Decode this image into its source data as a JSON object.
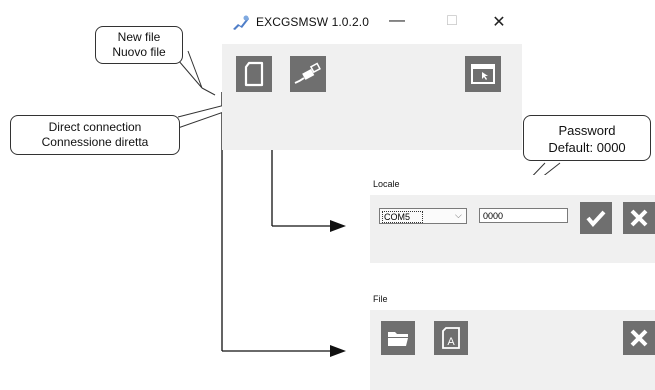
{
  "window": {
    "title": "EXCGSMSW 1.0.2.0",
    "controls": {
      "minimize": "—",
      "maximize": "□",
      "close": "✕"
    }
  },
  "toolbar": {
    "new_file_icon": "document-icon",
    "direct_connection_icon": "usb-cable-icon",
    "window_icon": "app-window-icon"
  },
  "callouts": {
    "new_file": [
      "New file",
      "Nuovo file"
    ],
    "direct_connection": [
      "Direct connection",
      "Connessione diretta"
    ],
    "password": [
      "Password",
      "Default: 0000"
    ]
  },
  "locale_panel": {
    "header": "Locale",
    "port_value": "COM5",
    "password_value": "0000",
    "confirm_icon": "checkmark-icon",
    "close_icon": "close-icon"
  },
  "file_panel": {
    "header": "File",
    "open_icon": "folder-icon",
    "file_a_icon": "document-a-icon",
    "close_icon": "close-icon"
  }
}
